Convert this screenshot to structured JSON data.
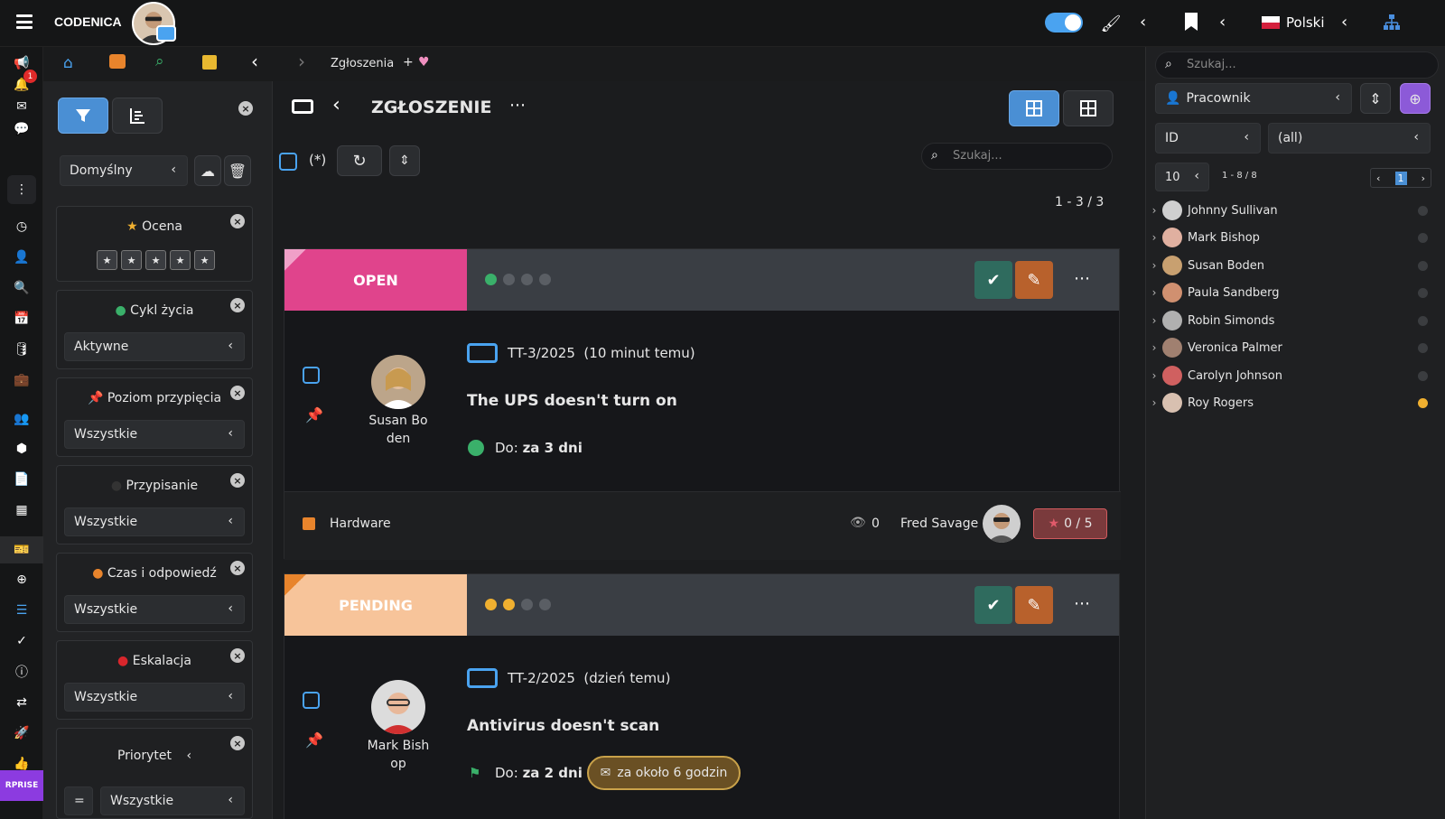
{
  "app": {
    "name": "CODENICA"
  },
  "topbar": {
    "language": "Polski"
  },
  "nav": {
    "breadcrumb": "Zgłoszenia",
    "plus": "+"
  },
  "left_badge": {
    "notifications": "1"
  },
  "enterprise_label": "RPRISE",
  "filters": {
    "preset": "Domyślny",
    "rating": {
      "title": "Ocena",
      "stars": [
        "★",
        "★",
        "★",
        "★",
        "★"
      ]
    },
    "lifecycle": {
      "title": "Cykl życia",
      "value": "Aktywne"
    },
    "pin_level": {
      "title": "Poziom przypięcia",
      "value": "Wszystkie"
    },
    "assignment": {
      "title": "Przypisanie",
      "value": "Wszystkie"
    },
    "time_response": {
      "title": "Czas i odpowiedź",
      "value": "Wszystkie"
    },
    "escalation": {
      "title": "Eskalacja",
      "value": "Wszystkie"
    },
    "priority": {
      "title": "Priorytet",
      "op": "=",
      "value": "Wszystkie"
    }
  },
  "main": {
    "title": "ZGŁOSZENIE",
    "selection_mark": "(*)",
    "search_placeholder": "Szukaj...",
    "count": "1 - 3 / 3"
  },
  "tickets": [
    {
      "status": "OPEN",
      "status_color": "#e0448c",
      "progress_filled": 1,
      "id": "TT-3/2025",
      "time": "(10 minut temu)",
      "title": "The UPS doesn't turn on",
      "assignee_line1": "Susan Bo",
      "assignee_line2": "den",
      "due_label": "Do:",
      "due_value": "za 3 dni",
      "category": "Hardware",
      "views": "0",
      "reporter": "Fred Savage",
      "rating": "0 / 5"
    },
    {
      "status": "PENDING",
      "status_color": "#f7c49a",
      "progress_filled": 2,
      "id": "TT-2/2025",
      "time": "(dzień temu)",
      "title": "Antivirus doesn't scan",
      "assignee_line1": "Mark Bish",
      "assignee_line2": "op",
      "due_label": "Do:",
      "due_value": "za 2 dni",
      "response": "za około 6 godzin"
    }
  ],
  "right": {
    "search_placeholder": "Szukaj...",
    "group_select": "Pracownik",
    "field_select": "ID",
    "value_select": "(all)",
    "page_size": "10",
    "range": "1 - 8 / 8",
    "page": "1",
    "people": [
      {
        "name": "Johnny Sullivan",
        "status": "#3b3d40"
      },
      {
        "name": "Mark Bishop",
        "status": "#3b3d40"
      },
      {
        "name": "Susan Boden",
        "status": "#3b3d40"
      },
      {
        "name": "Paula Sandberg",
        "status": "#3b3d40"
      },
      {
        "name": "Robin Simonds",
        "status": "#3b3d40"
      },
      {
        "name": "Veronica Palmer",
        "status": "#3b3d40"
      },
      {
        "name": "Carolyn Johnson",
        "status": "#3b3d40"
      },
      {
        "name": "Roy Rogers",
        "status": "#f0b030"
      }
    ]
  }
}
